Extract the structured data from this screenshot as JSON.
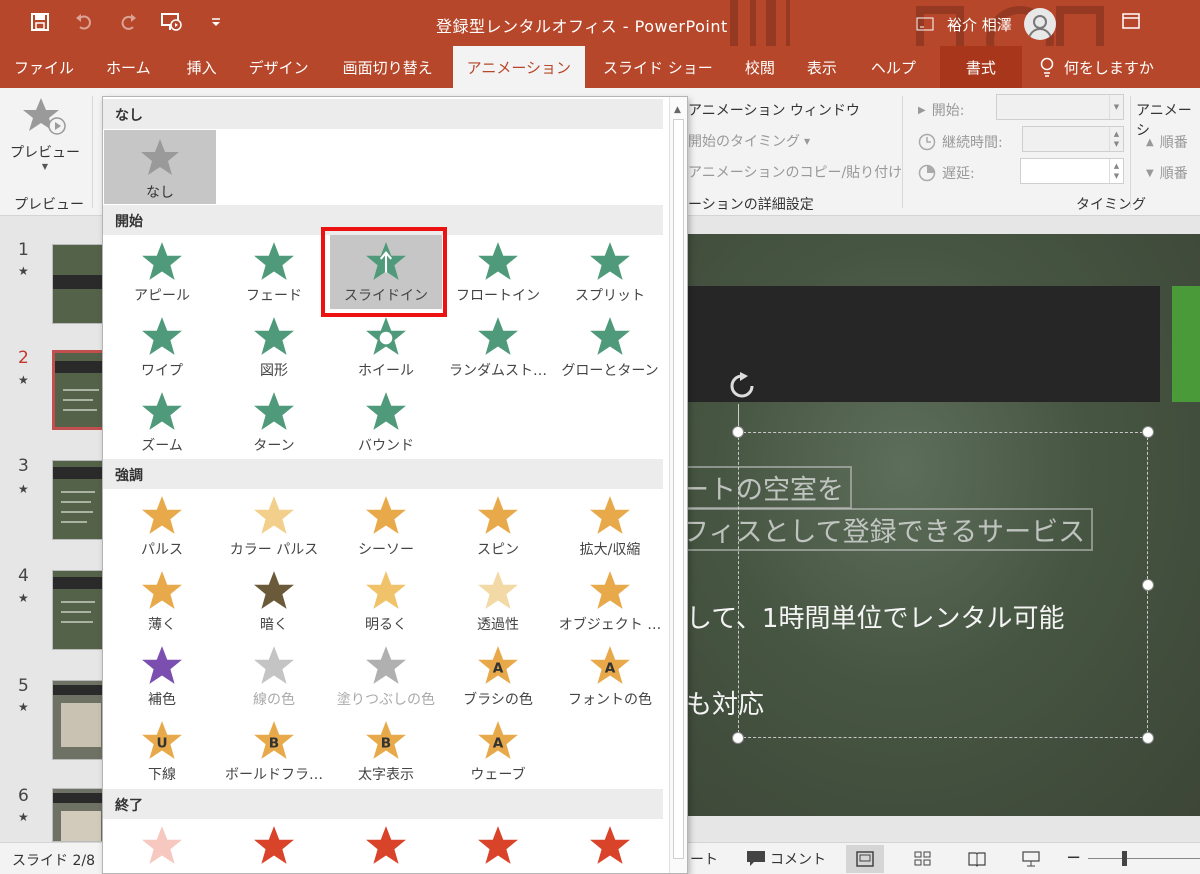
{
  "app": {
    "document_title": "登録型レンタルオフィス - PowerPoint",
    "user_name": "裕介 相澤"
  },
  "tabs": [
    {
      "label": "ファイル"
    },
    {
      "label": "ホーム"
    },
    {
      "label": "挿入"
    },
    {
      "label": "デザイン"
    },
    {
      "label": "画面切り替え"
    },
    {
      "label": "アニメーション"
    },
    {
      "label": "スライド ショー"
    },
    {
      "label": "校閲"
    },
    {
      "label": "表示"
    },
    {
      "label": "ヘルプ"
    },
    {
      "label": "書式"
    },
    {
      "label": "何をしますか"
    }
  ],
  "ribbon": {
    "preview_button": "プレビュー",
    "preview_group": "プレビュー",
    "animation_window": "アニメーション ウィンドウ",
    "trigger": "開始のタイミング",
    "painter": "アニメーションのコピー/貼り付け",
    "advanced_group": "ーションの詳細設定",
    "start_label": "開始:",
    "duration_label": "継続時間:",
    "delay_label": "遅延:",
    "timing_group": "タイミング",
    "reorder_title": "アニメーシ",
    "move_earlier": "順番",
    "move_later": "順番"
  },
  "gallery": {
    "sections": {
      "none": "なし",
      "entrance": "開始",
      "emphasis": "強調",
      "exit": "終了"
    },
    "none_item": "なし",
    "entrance_items": [
      "アピール",
      "フェード",
      "スライドイン",
      "フロートイン",
      "スプリット",
      "ワイプ",
      "図形",
      "ホイール",
      "ランダムスト…",
      "グローとターン",
      "ズーム",
      "ターン",
      "バウンド"
    ],
    "emphasis_items": [
      "パルス",
      "カラー パルス",
      "シーソー",
      "スピン",
      "拡大/収縮",
      "薄く",
      "暗く",
      "明るく",
      "透過性",
      "オブジェクト …",
      "補色",
      "線の色",
      "塗りつぶしの色",
      "ブラシの色",
      "フォントの色",
      "下線",
      "ボールドフラ…",
      "太字表示",
      "ウェーブ"
    ],
    "selected_item": "スライドイン"
  },
  "thumbnails": [
    {
      "number": "1",
      "star": "★"
    },
    {
      "number": "2",
      "star": "★"
    },
    {
      "number": "3",
      "star": "★"
    },
    {
      "number": "4",
      "star": "★"
    },
    {
      "number": "5",
      "star": "★"
    },
    {
      "number": "6",
      "star": "★"
    }
  ],
  "slide": {
    "line1": "ートの空室を",
    "line2": "フィスとして登録できるサービス",
    "line3": "して、1時間単位でレンタル可能",
    "line4": "も対応"
  },
  "status": {
    "slide_count": "スライド 2/8",
    "notes": "ノート",
    "comments": "コメント"
  },
  "colors": {
    "accent": "#b7472a",
    "selection_outline": "#ee1111",
    "entrance_icon": "#4f9a7a",
    "emphasis_icon": "#e8a94a",
    "exit_icon": "#d9432a"
  }
}
